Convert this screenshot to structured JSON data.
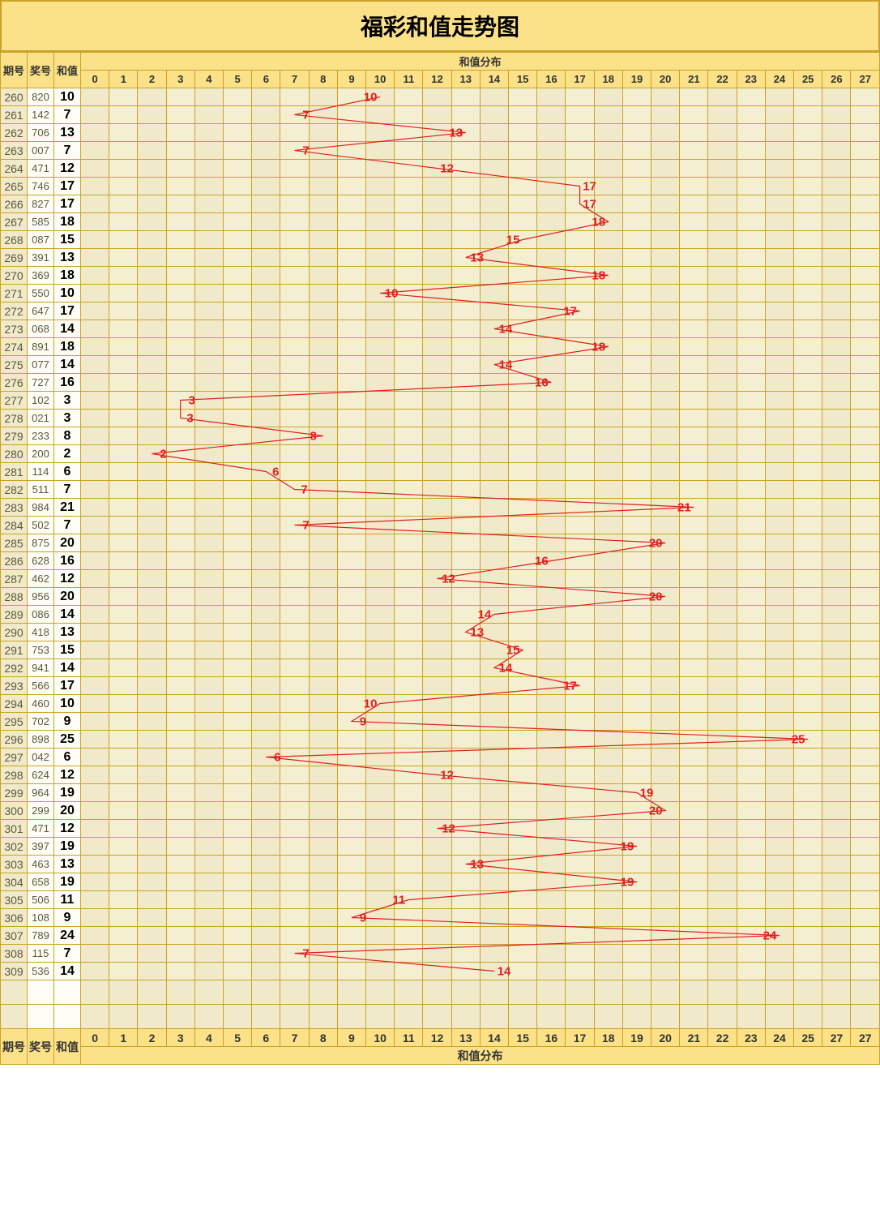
{
  "title": "福彩和值走势图",
  "headers": {
    "period": "期号",
    "award": "奖号",
    "sum": "和值",
    "dist": "和值分布"
  },
  "dist_range": [
    0,
    1,
    2,
    3,
    4,
    5,
    6,
    7,
    8,
    9,
    10,
    11,
    12,
    13,
    14,
    15,
    16,
    17,
    18,
    19,
    20,
    21,
    22,
    23,
    24,
    25,
    26,
    27
  ],
  "footer_dist": [
    0,
    1,
    2,
    3,
    4,
    5,
    6,
    7,
    8,
    9,
    10,
    11,
    12,
    13,
    14,
    15,
    16,
    17,
    18,
    19,
    20,
    21,
    22,
    23,
    24,
    25,
    27,
    27
  ],
  "rows": [
    {
      "period": "260",
      "award": "820",
      "sum": 10
    },
    {
      "period": "261",
      "award": "142",
      "sum": 7
    },
    {
      "period": "262",
      "award": "706",
      "sum": 13
    },
    {
      "period": "263",
      "award": "007",
      "sum": 7
    },
    {
      "period": "264",
      "award": "471",
      "sum": 12
    },
    {
      "period": "265",
      "award": "746",
      "sum": 17
    },
    {
      "period": "266",
      "award": "827",
      "sum": 17
    },
    {
      "period": "267",
      "award": "585",
      "sum": 18
    },
    {
      "period": "268",
      "award": "087",
      "sum": 15
    },
    {
      "period": "269",
      "award": "391",
      "sum": 13
    },
    {
      "period": "270",
      "award": "369",
      "sum": 18
    },
    {
      "period": "271",
      "award": "550",
      "sum": 10
    },
    {
      "period": "272",
      "award": "647",
      "sum": 17
    },
    {
      "period": "273",
      "award": "068",
      "sum": 14
    },
    {
      "period": "274",
      "award": "891",
      "sum": 18
    },
    {
      "period": "275",
      "award": "077",
      "sum": 14
    },
    {
      "period": "276",
      "award": "727",
      "sum": 16
    },
    {
      "period": "277",
      "award": "102",
      "sum": 3
    },
    {
      "period": "278",
      "award": "021",
      "sum": 3
    },
    {
      "period": "279",
      "award": "233",
      "sum": 8
    },
    {
      "period": "280",
      "award": "200",
      "sum": 2
    },
    {
      "period": "281",
      "award": "114",
      "sum": 6
    },
    {
      "period": "282",
      "award": "511",
      "sum": 7
    },
    {
      "period": "283",
      "award": "984",
      "sum": 21
    },
    {
      "period": "284",
      "award": "502",
      "sum": 7
    },
    {
      "period": "285",
      "award": "875",
      "sum": 20
    },
    {
      "period": "286",
      "award": "628",
      "sum": 16
    },
    {
      "period": "287",
      "award": "462",
      "sum": 12
    },
    {
      "period": "288",
      "award": "956",
      "sum": 20
    },
    {
      "period": "289",
      "award": "086",
      "sum": 14
    },
    {
      "period": "290",
      "award": "418",
      "sum": 13
    },
    {
      "period": "291",
      "award": "753",
      "sum": 15
    },
    {
      "period": "292",
      "award": "941",
      "sum": 14
    },
    {
      "period": "293",
      "award": "566",
      "sum": 17
    },
    {
      "period": "294",
      "award": "460",
      "sum": 10
    },
    {
      "period": "295",
      "award": "702",
      "sum": 9
    },
    {
      "period": "296",
      "award": "898",
      "sum": 25
    },
    {
      "period": "297",
      "award": "042",
      "sum": 6
    },
    {
      "period": "298",
      "award": "624",
      "sum": 12
    },
    {
      "period": "299",
      "award": "964",
      "sum": 19
    },
    {
      "period": "300",
      "award": "299",
      "sum": 20
    },
    {
      "period": "301",
      "award": "471",
      "sum": 12
    },
    {
      "period": "302",
      "award": "397",
      "sum": 19
    },
    {
      "period": "303",
      "award": "463",
      "sum": 13
    },
    {
      "period": "304",
      "award": "658",
      "sum": 19
    },
    {
      "period": "305",
      "award": "506",
      "sum": 11
    },
    {
      "period": "306",
      "award": "108",
      "sum": 9
    },
    {
      "period": "307",
      "award": "789",
      "sum": 24
    },
    {
      "period": "308",
      "award": "115",
      "sum": 7
    },
    {
      "period": "309",
      "award": "536",
      "sum": 14
    }
  ],
  "chart_data": {
    "type": "line",
    "title": "福彩和值走势图",
    "xlabel": "和值分布",
    "ylabel": "期号",
    "x_range": [
      0,
      27
    ],
    "categories": [
      "260",
      "261",
      "262",
      "263",
      "264",
      "265",
      "266",
      "267",
      "268",
      "269",
      "270",
      "271",
      "272",
      "273",
      "274",
      "275",
      "276",
      "277",
      "278",
      "279",
      "280",
      "281",
      "282",
      "283",
      "284",
      "285",
      "286",
      "287",
      "288",
      "289",
      "290",
      "291",
      "292",
      "293",
      "294",
      "295",
      "296",
      "297",
      "298",
      "299",
      "300",
      "301",
      "302",
      "303",
      "304",
      "305",
      "306",
      "307",
      "308",
      "309"
    ],
    "values": [
      10,
      7,
      13,
      7,
      12,
      17,
      17,
      18,
      15,
      13,
      18,
      10,
      17,
      14,
      18,
      14,
      16,
      3,
      3,
      8,
      2,
      6,
      7,
      21,
      7,
      20,
      16,
      12,
      20,
      14,
      13,
      15,
      14,
      17,
      10,
      9,
      25,
      6,
      12,
      19,
      20,
      12,
      19,
      13,
      19,
      11,
      9,
      24,
      7,
      14
    ]
  }
}
